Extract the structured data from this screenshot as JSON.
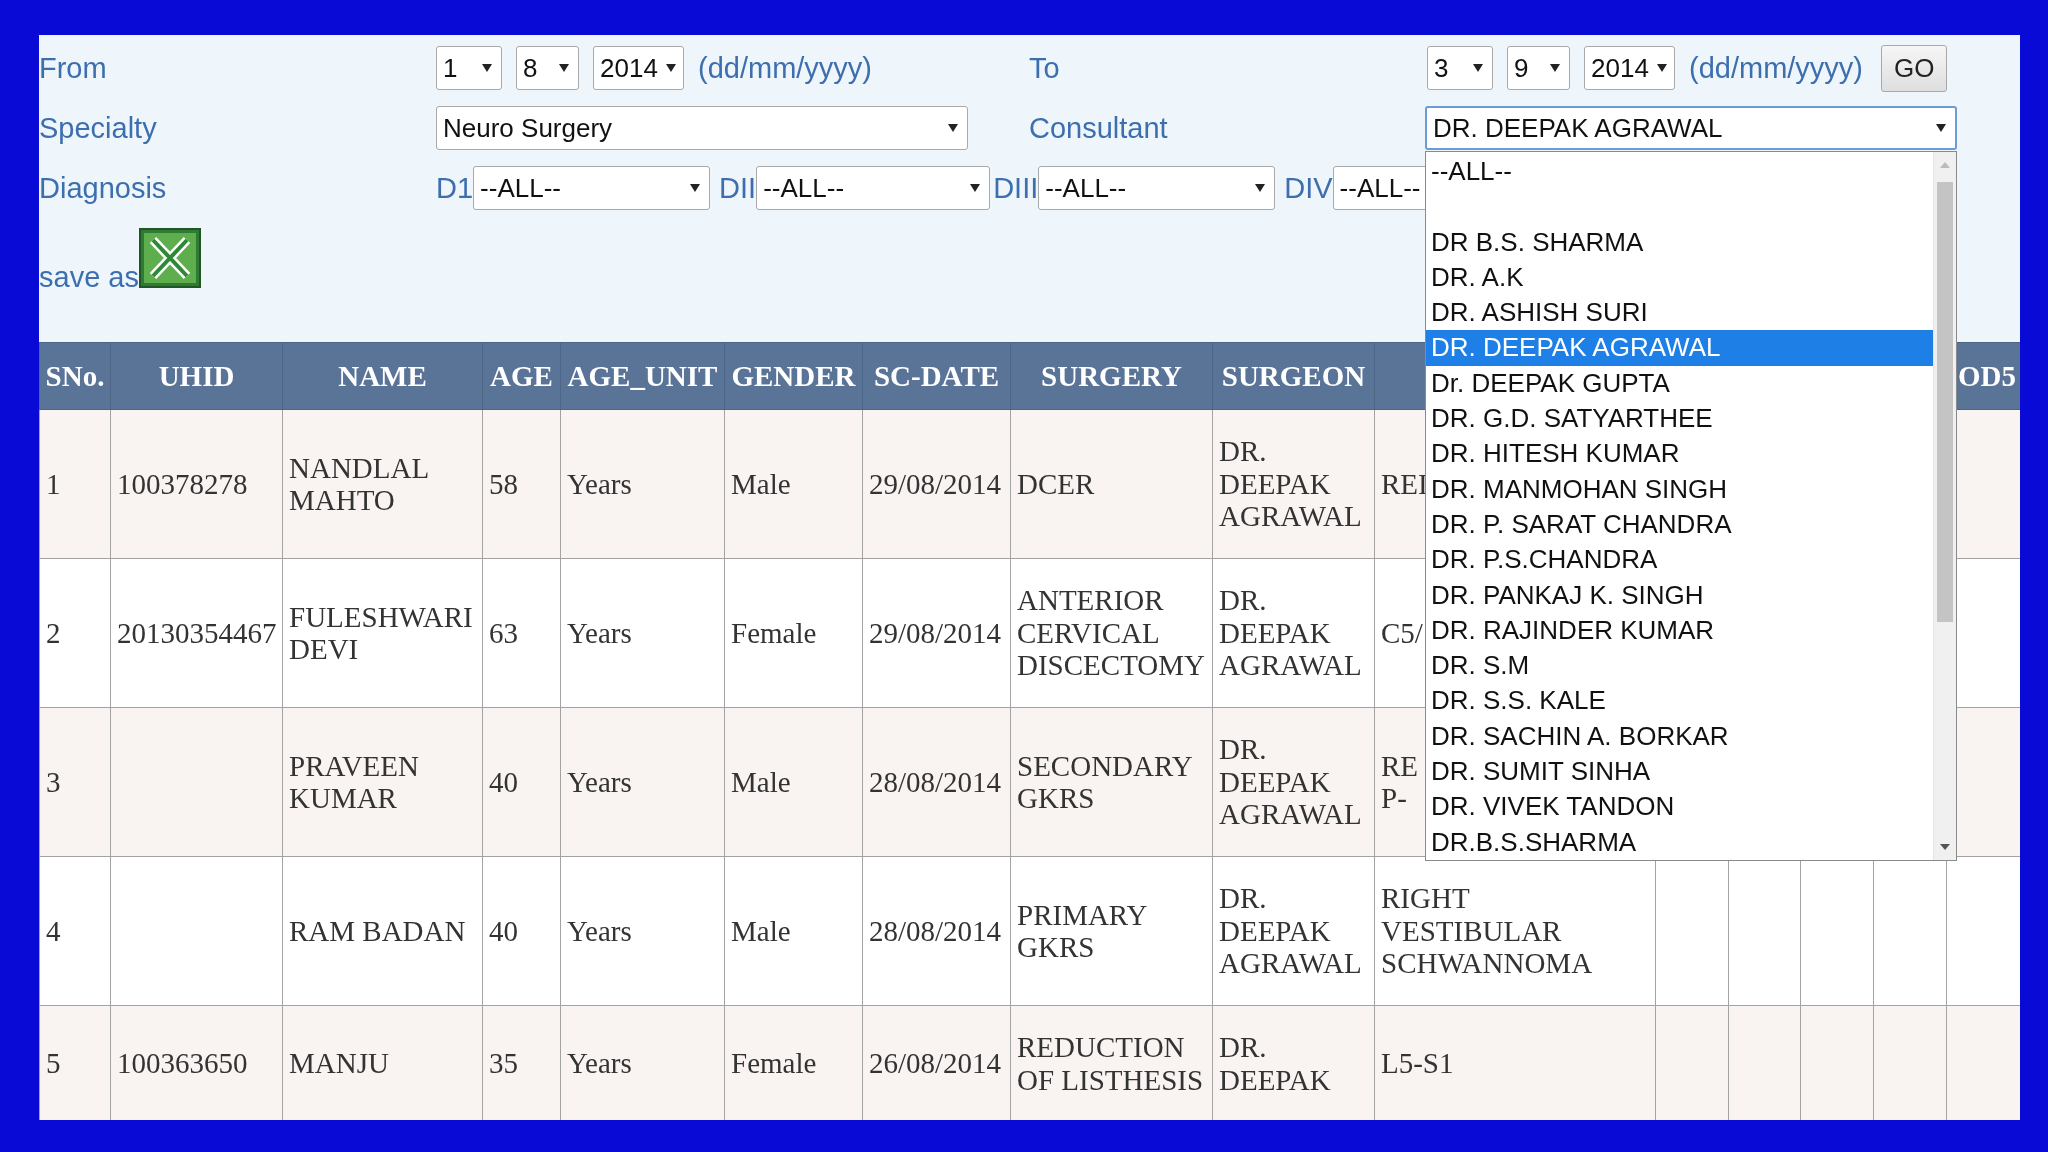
{
  "filters": {
    "from": {
      "label": "From",
      "day": "1",
      "month": "8",
      "year": "2014",
      "format_hint": "(dd/mm/yyyy)"
    },
    "to": {
      "label": "To",
      "day": "3",
      "month": "9",
      "year": "2014",
      "format_hint": "(dd/mm/yyyy)",
      "button": "GO"
    },
    "specialty": {
      "label": "Specialty",
      "value": "Neuro Surgery"
    },
    "consultant": {
      "label": "Consultant",
      "value": "DR. DEEPAK AGRAWAL",
      "expanded": true,
      "options": [
        {
          "kind": "option",
          "label": "--ALL--",
          "selected": false
        },
        {
          "kind": "blank",
          "selected": false
        },
        {
          "kind": "option",
          "label": "DR B.S. SHARMA",
          "selected": false
        },
        {
          "kind": "option",
          "label": "DR. A.K",
          "selected": false
        },
        {
          "kind": "option",
          "label": "DR. ASHISH SURI",
          "selected": false
        },
        {
          "kind": "option",
          "label": "DR. DEEPAK AGRAWAL",
          "selected": true
        },
        {
          "kind": "option",
          "label": "Dr. DEEPAK GUPTA",
          "selected": false
        },
        {
          "kind": "option",
          "label": "DR. G.D. SATYARTHEE",
          "selected": false
        },
        {
          "kind": "option",
          "label": "DR. HITESH KUMAR",
          "selected": false
        },
        {
          "kind": "option",
          "label": "DR. MANMOHAN SINGH",
          "selected": false
        },
        {
          "kind": "option",
          "label": "DR. P. SARAT CHANDRA",
          "selected": false
        },
        {
          "kind": "option",
          "label": "DR. P.S.CHANDRA",
          "selected": false
        },
        {
          "kind": "option",
          "label": "DR. PANKAJ K. SINGH",
          "selected": false
        },
        {
          "kind": "option",
          "label": "DR. RAJINDER KUMAR",
          "selected": false
        },
        {
          "kind": "option",
          "label": "DR. S.M",
          "selected": false
        },
        {
          "kind": "option",
          "label": "DR. S.S. KALE",
          "selected": false
        },
        {
          "kind": "option",
          "label": "DR. SACHIN A. BORKAR",
          "selected": false
        },
        {
          "kind": "option",
          "label": "DR. SUMIT SINHA",
          "selected": false
        },
        {
          "kind": "option",
          "label": "DR. VIVEK TANDON",
          "selected": false
        },
        {
          "kind": "option",
          "label": "DR.B.S.SHARMA",
          "selected": false
        }
      ]
    },
    "diagnosis": {
      "label": "Diagnosis",
      "fields": [
        {
          "label": "D1",
          "value": "--ALL--"
        },
        {
          "label": "DII",
          "value": "--ALL--"
        },
        {
          "label": "DIII",
          "value": "--ALL--"
        },
        {
          "label": "DIV",
          "value": "--ALL--"
        }
      ]
    },
    "export": {
      "label": "save as"
    }
  },
  "table": {
    "columns": [
      "SNo.",
      "UHID",
      "NAME",
      "AGE",
      "AGE_UNIT",
      "GENDER",
      "SC-DATE",
      "SURGERY",
      "SURGEON",
      null,
      null,
      null,
      null,
      null,
      "OD5"
    ],
    "rows": [
      [
        "1",
        "100378278",
        "NANDLAL MAHTO",
        "58",
        "Years",
        "Male",
        "29/08/2014",
        "DCER",
        "DR. DEEPAK AGRAWAL",
        "REI",
        null,
        null,
        null,
        null,
        null
      ],
      [
        "2",
        "20130354467",
        "FULESHWARI DEVI",
        "63",
        "Years",
        "Female",
        "29/08/2014",
        "ANTERIOR CERVICAL DISCECTOMY",
        "DR. DEEPAK AGRAWAL",
        "C5/",
        null,
        null,
        null,
        null,
        null
      ],
      [
        "3",
        null,
        "PRAVEEN KUMAR",
        "40",
        "Years",
        "Male",
        "28/08/2014",
        "SECONDARY GKRS",
        "DR. DEEPAK AGRAWAL",
        "RE\nP-",
        null,
        null,
        null,
        null,
        null
      ],
      [
        "4",
        null,
        "RAM BADAN",
        "40",
        "Years",
        "Male",
        "28/08/2014",
        "PRIMARY GKRS",
        "DR. DEEPAK AGRAWAL",
        "RIGHT VESTIBULAR SCHWANNOMA",
        null,
        null,
        null,
        null,
        null
      ],
      [
        "5",
        "100363650",
        "MANJU",
        "35",
        "Years",
        "Female",
        "26/08/2014",
        "REDUCTION OF LISTHESIS",
        "DR. DEEPAK",
        "L5-S1",
        null,
        null,
        null,
        null,
        null
      ]
    ]
  }
}
